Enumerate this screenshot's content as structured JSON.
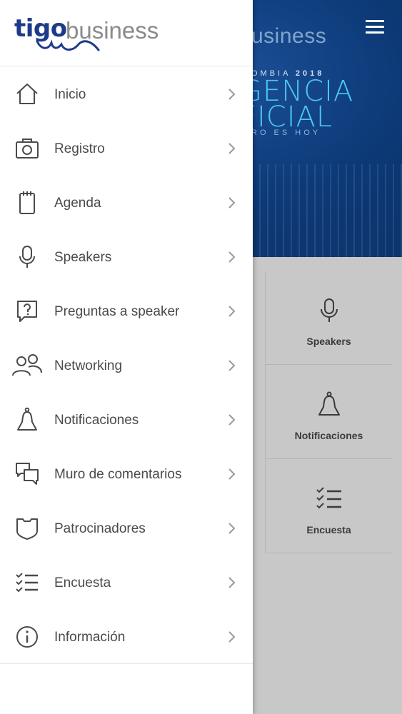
{
  "background_app": {
    "hero": {
      "logo_fragment": "usiness",
      "subtitle": "OMBIA",
      "year": "2018",
      "title_line1": "GENCIA",
      "title_line2": "FICIAL",
      "tagline": "RO ES HOY"
    },
    "tiles": [
      {
        "label": "Speakers",
        "icon": "microphone-icon"
      },
      {
        "label": "Notificaciones",
        "icon": "bell-icon"
      },
      {
        "label": "Encuesta",
        "icon": "checklist-icon"
      }
    ]
  },
  "drawer": {
    "logo": {
      "brand": "tigo",
      "word": "business"
    },
    "menu": [
      {
        "label": "Inicio",
        "icon": "home-icon"
      },
      {
        "label": "Registro",
        "icon": "camera-icon"
      },
      {
        "label": "Agenda",
        "icon": "notebook-icon"
      },
      {
        "label": "Speakers",
        "icon": "microphone-icon"
      },
      {
        "label": "Preguntas a speaker",
        "icon": "question-bubble-icon"
      },
      {
        "label": "Networking",
        "icon": "people-icon"
      },
      {
        "label": "Notificaciones",
        "icon": "bell-icon"
      },
      {
        "label": "Muro de comentarios",
        "icon": "chat-bubbles-icon"
      },
      {
        "label": "Patrocinadores",
        "icon": "shield-icon"
      },
      {
        "label": "Encuesta",
        "icon": "checklist-icon"
      },
      {
        "label": "Información",
        "icon": "info-icon"
      }
    ]
  },
  "colors": {
    "brand_blue": "#1d3a8a",
    "hero_blue": "#0d3a78",
    "accent_cyan": "#4cc6f0",
    "overlay_gray": "#c8c8c8"
  }
}
